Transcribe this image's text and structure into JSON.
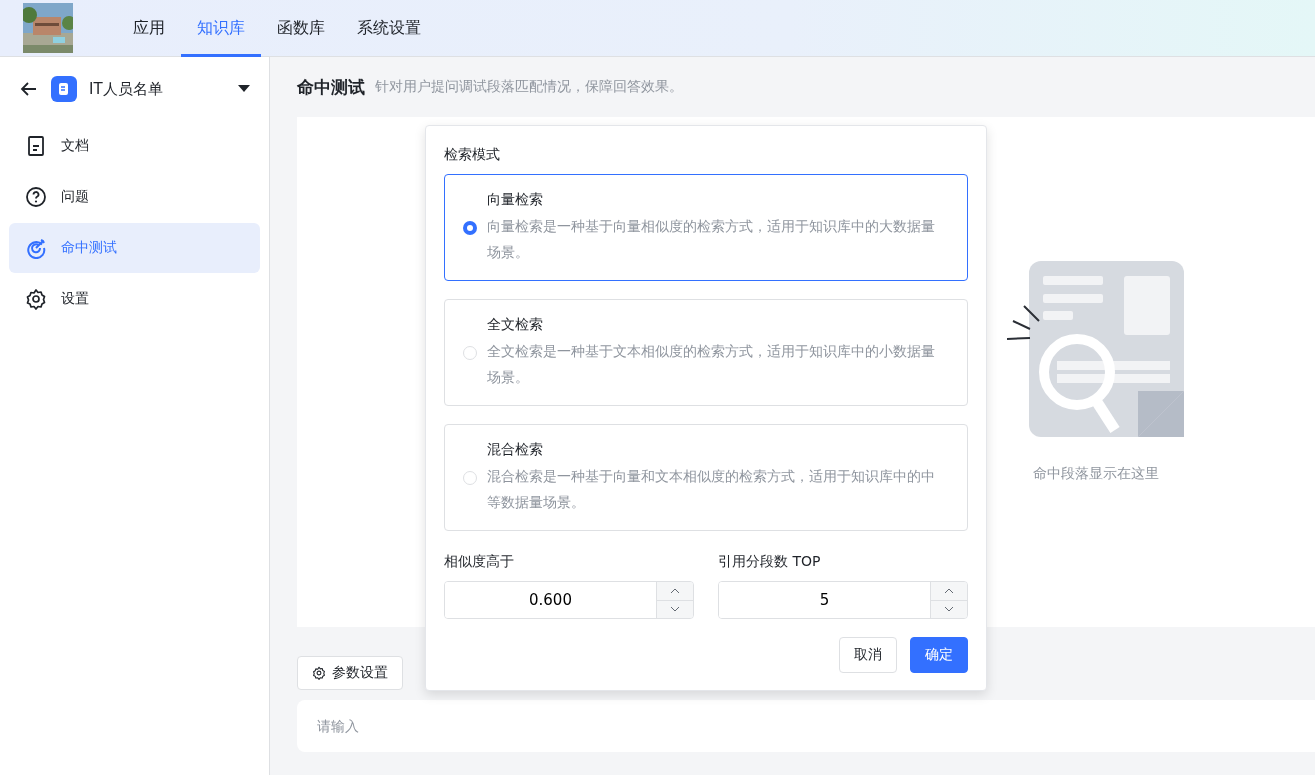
{
  "nav": {
    "tabs": [
      {
        "label": "应用",
        "selected": false
      },
      {
        "label": "知识库",
        "selected": true
      },
      {
        "label": "函数库",
        "selected": false
      },
      {
        "label": "系统设置",
        "selected": false
      }
    ]
  },
  "sidebar": {
    "title": "IT人员名单",
    "items": [
      {
        "label": "文档",
        "kind": "doc",
        "selected": false
      },
      {
        "label": "问题",
        "kind": "question",
        "selected": false
      },
      {
        "label": "命中测试",
        "kind": "target",
        "selected": true
      },
      {
        "label": "设置",
        "kind": "gear",
        "selected": false
      }
    ]
  },
  "page": {
    "title": "命中测试",
    "subtitle": "针对用户提问调试段落匹配情况，保障回答效果。"
  },
  "empty_state": {
    "text": "命中段落显示在这里"
  },
  "settings_popover": {
    "mode_label": "检索模式",
    "options": [
      {
        "title": "向量检索",
        "description": "向量检索是一种基于向量相似度的检索方式，适用于知识库中的大数据量场景。",
        "selected": true
      },
      {
        "title": "全文检索",
        "description": "全文检索是一种基于文本相似度的检索方式，适用于知识库中的小数据量场景。",
        "selected": false
      },
      {
        "title": "混合检索",
        "description": "混合检索是一种基于向量和文本相似度的检索方式，适用于知识库中的中等数据量场景。",
        "selected": false
      }
    ],
    "fields": [
      {
        "label": "相似度高于",
        "value": "0.600"
      },
      {
        "label": "引用分段数 TOP",
        "value": "5"
      }
    ],
    "cancel": "取消",
    "confirm": "确定"
  },
  "param_button": "参数设置",
  "question_input": {
    "placeholder": "请输入"
  }
}
